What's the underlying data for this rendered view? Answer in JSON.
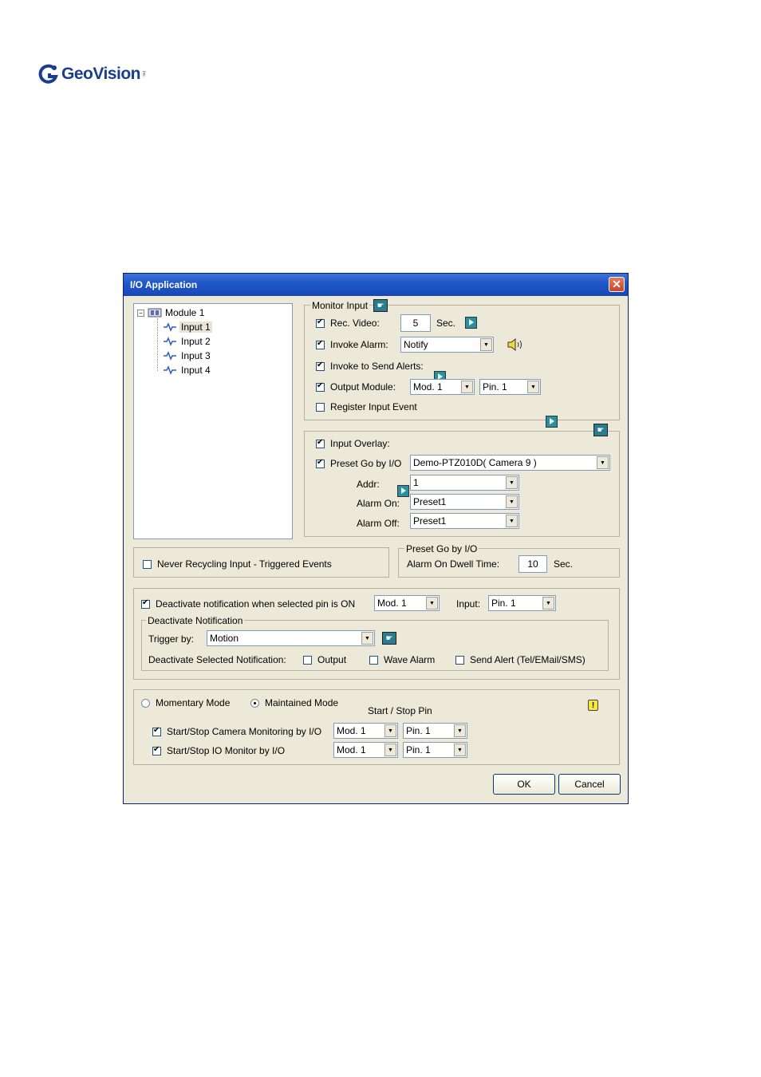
{
  "logo": {
    "text": "GeoVision",
    "tm": "Inc."
  },
  "dialog": {
    "title": "I/O Application",
    "tree": {
      "module": "Module 1",
      "inputs": [
        "Input 1",
        "Input 2",
        "Input 3",
        "Input 4"
      ]
    },
    "monitor_input": {
      "legend": "Monitor Input",
      "rec_video_label": "Rec. Video:",
      "rec_video_value": "5",
      "sec_label": "Sec.",
      "invoke_alarm_label": "Invoke Alarm:",
      "invoke_alarm_value": "Notify",
      "send_alerts_label": "Invoke to Send Alerts:",
      "output_module_label": "Output Module:",
      "output_module_value": "Mod. 1",
      "output_pin_value": "Pin. 1",
      "register_label": "Register Input Event"
    },
    "ptz": {
      "input_overlay_label": "Input Overlay:",
      "preset_label": "Preset Go by I/O",
      "preset_value": "Demo-PTZ010D( Camera 9 )",
      "addr_label": "Addr:",
      "addr_value": "1",
      "alarm_on_label": "Alarm On:",
      "alarm_on_value": "Preset1",
      "alarm_off_label": "Alarm Off:",
      "alarm_off_value": "Preset1"
    },
    "never_recycling_label": "Never Recycling Input - Triggered Events",
    "dwell": {
      "legend": "Preset Go by I/O",
      "label": "Alarm On Dwell Time:",
      "value": "10",
      "unit": "Sec."
    },
    "deactivate": {
      "label": "Deactivate notification when selected pin is ON",
      "mod_value": "Mod. 1",
      "input_label": "Input:",
      "pin_value": "Pin. 1",
      "legend": "Deactivate Notification",
      "trigger_label": "Trigger by:",
      "trigger_value": "Motion",
      "selected_label": "Deactivate Selected Notification:",
      "output_label": "Output",
      "wave_label": "Wave Alarm",
      "alert_label": "Send Alert (Tel/EMail/SMS)"
    },
    "mode": {
      "momentary_label": "Momentary Mode",
      "maintained_label": "Maintained Mode",
      "start_stop_label": "Start / Stop Pin",
      "camera_label": "Start/Stop Camera Monitoring by I/O",
      "camera_mod": "Mod. 1",
      "camera_pin": "Pin. 1",
      "io_label": "Start/Stop IO Monitor by I/O",
      "io_mod": "Mod. 1",
      "io_pin": "Pin. 1"
    },
    "ok_label": "OK",
    "cancel_label": "Cancel"
  },
  "colors": {
    "titlebar": "#1f56c8",
    "dialog_bg": "#ece9d8",
    "logo": "#1a3d8f"
  }
}
